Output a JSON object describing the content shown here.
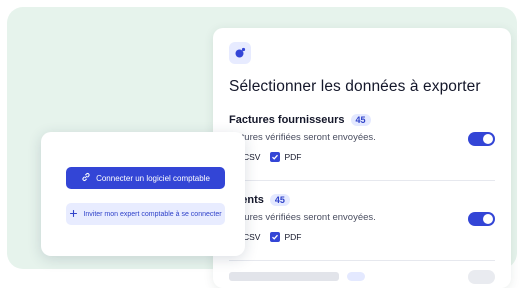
{
  "export_card": {
    "title": "Sélectionner les données à exporter",
    "icon": "planet-icon",
    "sections": [
      {
        "title": "Factures fournisseurs",
        "count": "45",
        "description": "factures vérifiées seront envoyées.",
        "toggle_on": true,
        "formats": [
          "CSV",
          "PDF"
        ]
      },
      {
        "title": "clients",
        "count": "45",
        "description": "factures vérifiées seront envoyées.",
        "toggle_on": true,
        "formats": [
          "CSV",
          "PDF"
        ]
      },
      {
        "title": "",
        "count": "",
        "toggle_on": false
      }
    ]
  },
  "connect_card": {
    "primary_button": "Connecter un logiciel comptable",
    "primary_icon": "link-icon",
    "secondary_button": "Inviter mon expert comptable à se connecter",
    "secondary_icon": "plus-icon"
  },
  "colors": {
    "accent": "#3345d6",
    "background": "#e6f3ec",
    "badge_bg": "#e4e9ff"
  }
}
